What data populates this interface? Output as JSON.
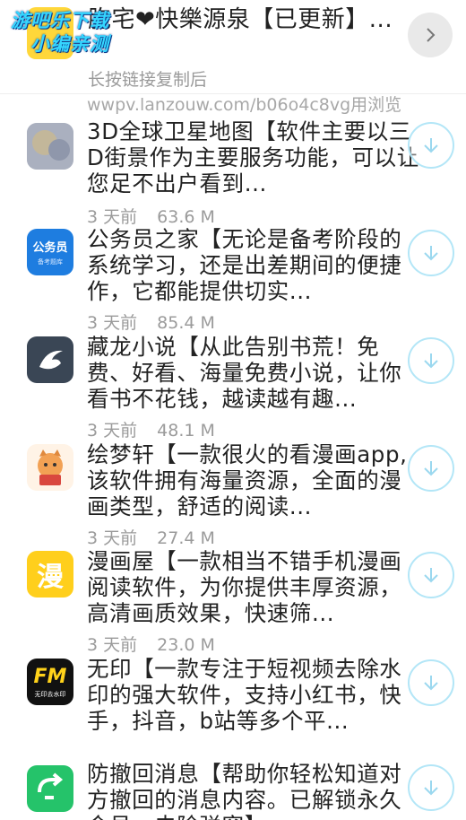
{
  "header": {
    "title": "胞宅❤快樂源泉【已更新】...",
    "subtitle": "长按链接复制后",
    "link_text": "wwpv.lanzouw.com/b06o4c8vg用浏览",
    "watermark_line1": "游吧乐下载",
    "watermark_line2": "小编亲测",
    "next_icon": "chevron-right-icon"
  },
  "items": [
    {
      "title": "3D全球卫星地图【软件主要以三D街景作为主要服务功能，可以让您足不出户看到...",
      "age": "3 天前",
      "size": "63.6 M",
      "icon": "satellite-map-icon"
    },
    {
      "title": "公务员之家【无论是备考阶段的系统学习，还是出差期间的便捷作，它都能提供切实...",
      "age": "3 天前",
      "size": "85.4 M",
      "icon": "civil-servant-icon",
      "icon_text": "公务员",
      "icon_sub": "备考题库"
    },
    {
      "title": "藏龙小说【从此告别书荒！免费、好看、海量免费小说，让你看书不花钱，越读越有趣...",
      "age": "3 天前",
      "size": "48.1 M",
      "icon": "novel-icon"
    },
    {
      "title": "绘梦轩【一款很火的看漫画app,该软件拥有海量资源，全面的漫画类型，舒适的阅读...",
      "age": "3 天前",
      "size": "27.4 M",
      "icon": "cat-reading-icon"
    },
    {
      "title": "漫画屋【一款相当不错手机漫画阅读软件，为你提供丰厚资源，高清画质效果，快速筛...",
      "age": "3 天前",
      "size": "23.0 M",
      "icon": "manga-icon",
      "icon_text": "漫"
    },
    {
      "title": "无印【一款专注于短视频去除水印的强大软件，支持小红书，快手，抖音，b站等多个平...",
      "age": "3 天前",
      "size": "",
      "icon": "watermark-remover-icon",
      "icon_text": "无印去水印"
    },
    {
      "title": "防撤回消息【帮助你轻松知道对方撤回的消息内容。已解锁永久会员，去除弹窗】...",
      "age": "",
      "size": "",
      "icon": "anti-recall-icon"
    }
  ],
  "colors": {
    "download_ring": "#b3e6f7",
    "meta": "#9b9b9b",
    "watermark": "#35d6ff"
  }
}
